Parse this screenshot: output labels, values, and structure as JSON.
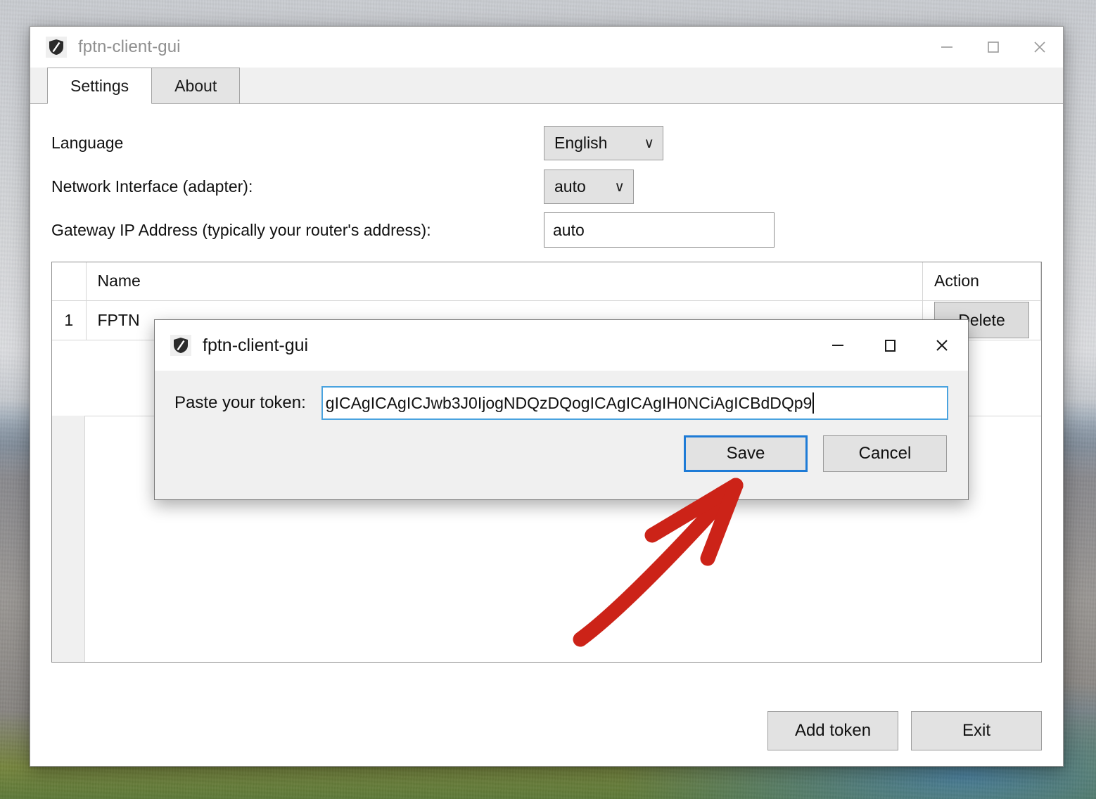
{
  "main_window": {
    "title": "fptn-client-gui",
    "icon": "shield-icon",
    "controls": {
      "minimize": "—",
      "maximize": "□",
      "close": "✕"
    },
    "tabs": [
      {
        "label": "Settings",
        "active": true
      },
      {
        "label": "About",
        "active": false
      }
    ],
    "settings": {
      "language": {
        "label": "Language",
        "value": "English",
        "caret": "∨"
      },
      "adapter": {
        "label": "Network Interface (adapter):",
        "value": "auto",
        "caret": "∨"
      },
      "gateway": {
        "label": "Gateway IP Address (typically your router's address):",
        "value": "auto"
      }
    },
    "tokens_table": {
      "columns": [
        "",
        "Name",
        "Action"
      ],
      "rows": [
        {
          "num": "1",
          "name": "FPTN",
          "action": "Delete"
        }
      ]
    },
    "footer_buttons": [
      {
        "label": "Add token"
      },
      {
        "label": "Exit"
      }
    ]
  },
  "dialog": {
    "title": "fptn-client-gui",
    "icon": "shield-icon",
    "controls": {
      "minimize": "—",
      "maximize": "□",
      "close": "✕"
    },
    "token_label": "Paste your token:",
    "token_value": "gICAgICAgICJwb3J0IjogNDQzDQogICAgICAgIH0NCiAgICBdDQp9",
    "buttons": [
      {
        "label": "Save",
        "default": true
      },
      {
        "label": "Cancel",
        "default": false
      }
    ]
  },
  "annotation": {
    "type": "arrow",
    "color": "#cc2318",
    "points_to": "Save"
  }
}
